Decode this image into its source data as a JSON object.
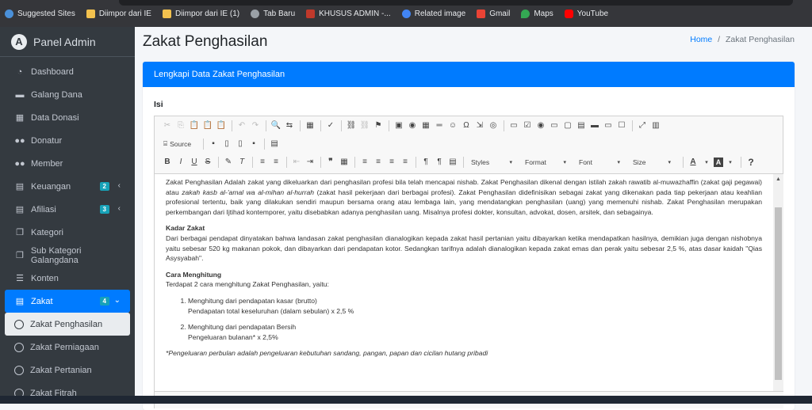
{
  "bookmarks": [
    {
      "label": "Suggested Sites",
      "color": "#4a90d9"
    },
    {
      "label": "Diimpor dari IE",
      "color": "#f2c14e"
    },
    {
      "label": "Diimpor dari IE (1)",
      "color": "#f2c14e"
    },
    {
      "label": "Tab Baru",
      "color": "#9aa0a6"
    },
    {
      "label": "KHUSUS ADMIN -...",
      "color": "#c0392b"
    },
    {
      "label": "Related image",
      "color": "#4285f4"
    },
    {
      "label": "Gmail",
      "color": "#ea4335"
    },
    {
      "label": "Maps",
      "color": "#34a853"
    },
    {
      "label": "YouTube",
      "color": "#ff0000"
    }
  ],
  "sidebar": {
    "brand": "Panel Admin",
    "brand_logo": "A",
    "items": [
      {
        "label": "Dashboard",
        "icon": "tachometer-icon",
        "glyph": "◔"
      },
      {
        "label": "Galang Dana",
        "icon": "briefcase-icon",
        "glyph": "▬"
      },
      {
        "label": "Data Donasi",
        "icon": "table-icon",
        "glyph": "▦"
      },
      {
        "label": "Donatur",
        "icon": "users-icon",
        "glyph": "👥"
      },
      {
        "label": "Member",
        "icon": "users-icon",
        "glyph": "👥"
      },
      {
        "label": "Keuangan",
        "icon": "file-icon",
        "glyph": "▤",
        "badge": "2"
      },
      {
        "label": "Afiliasi",
        "icon": "file-icon",
        "glyph": "▤",
        "badge": "3"
      },
      {
        "label": "Kategori",
        "icon": "copy-icon",
        "glyph": "❐"
      },
      {
        "label": "Sub Kategori Galangdana",
        "icon": "copy-icon",
        "glyph": "❐"
      },
      {
        "label": "Konten",
        "icon": "list-icon",
        "glyph": "☰"
      },
      {
        "label": "Zakat",
        "icon": "file-icon",
        "glyph": "▤",
        "badge": "4"
      }
    ],
    "subitems": [
      {
        "label": "Zakat Penghasilan"
      },
      {
        "label": "Zakat Perniagaan"
      },
      {
        "label": "Zakat Pertanian"
      },
      {
        "label": "Zakat Fitrah"
      }
    ]
  },
  "page": {
    "title": "Zakat Penghasilan",
    "breadcrumb_home": "Home",
    "breadcrumb_sep": "/",
    "breadcrumb_current": "Zakat Penghasilan"
  },
  "card": {
    "header": "Lengkapi Data Zakat Penghasilan",
    "field_label": "Isi"
  },
  "toolbar": {
    "source_label": "Source",
    "styles": "Styles",
    "format": "Format",
    "font": "Font",
    "size": "Size"
  },
  "content": {
    "p1_a": "Zakat Penghasilan Adalah zakat yang dikeluarkan dari penghasilan profesi bila telah mencapai nishab. Zakat Penghasilan dikenal dengan istilah zakah rawatib al-muwazhaffin (zakat gaji pegawai) atau ",
    "p1_em": "zakah kasb al-'amal wa al-mihan al-hurrah",
    "p1_b": " (zakat hasil pekerjaan dari berbagai profesi). Zakat Penghasilan didefinisikan sebagai zakat yang dikenakan pada tiap pekerjaan atau keahlian profesional tertentu, baik yang dilakukan sendiri maupun bersama orang atau lembaga lain, yang mendatangkan penghasilan (uang) yang memenuhi nishab. Zakat Penghasilan merupakan perkembangan dari Ijtihad  kontemporer, yaitu disebabkan adanya penghasilan uang. Misalnya profesi dokter, konsultan, advokat, dosen, arsitek, dan sebagainya.",
    "h2": "Kadar Zakat",
    "p2": "Dari berbagai pendapat dinyatakan bahwa landasan zakat penghasilan dianalogikan kepada zakat hasil pertanian yaitu dibayarkan ketika mendapatkan hasilnya, demikian juga dengan nishobnya yaitu sebesar 520 kg makanan pokok, dan dibayarkan dari pendapatan kotor. Sedangkan tarifnya adalah dianalogikan kepada zakat emas dan perak yaitu sebesar 2,5 %, atas dasar kaidah \"Qias Asysyabah\".",
    "h3": "Cara Menghitung",
    "p3": "Terdapat 2 cara menghitung Zakat Penghasilan, yaitu:",
    "li1_title": "Menghitung dari pendapatan kasar (brutto)",
    "li1_text": "Pendapatan total keseluruhan (dalam sebulan) x 2,5 %",
    "li2_title": "Menghitung dari pendapatan Bersih",
    "li2_text": "Pengeluaran bulanan* x 2,5%",
    "note": "*Pengeluaran perbulan adalah pengeluaran kebutuhan sandang, pangan, papan dan cicilan hutang pribadi"
  }
}
